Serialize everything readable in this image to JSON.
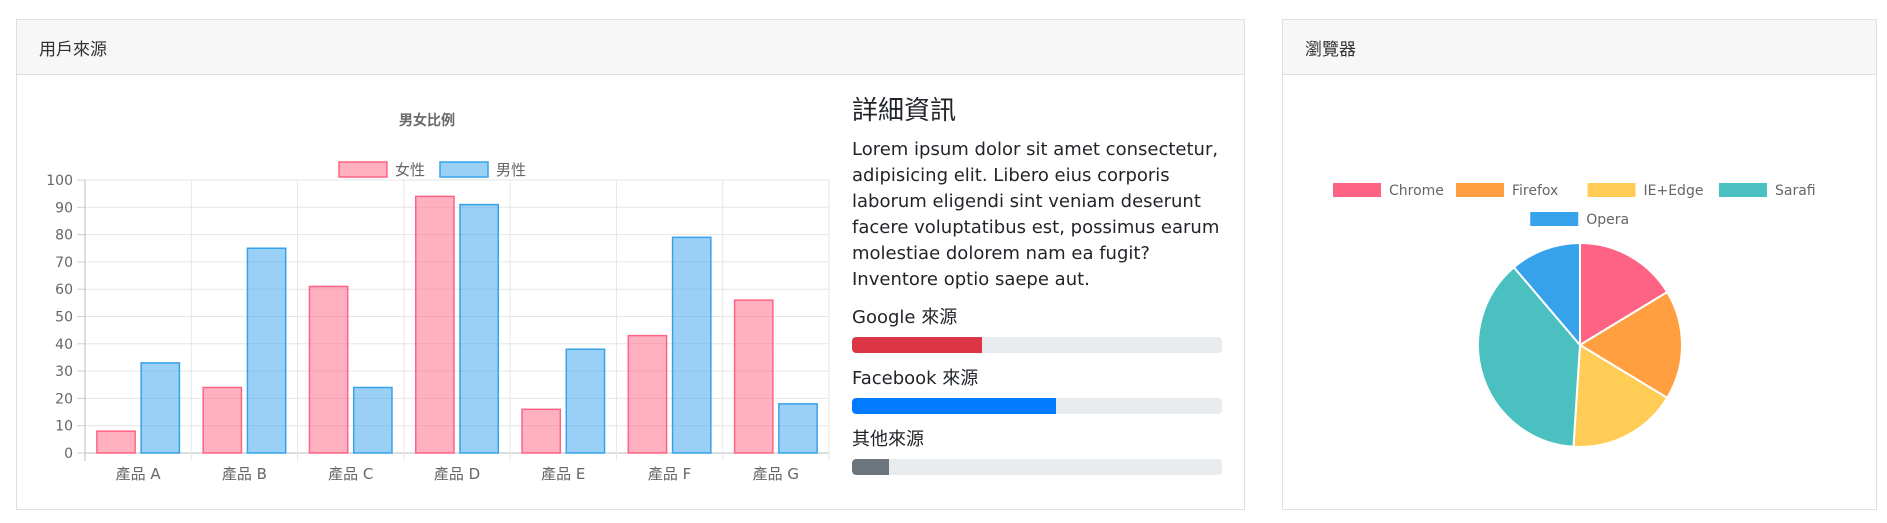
{
  "source_card": {
    "title": "用戶來源",
    "details": {
      "heading": "詳細資訊",
      "body": "Lorem ipsum dolor sit amet consectetur, adipisicing elit. Libero eius corporis laborum eligendi sint veniam deserunt facere voluptatibus est, possimus earum molestiae dolorem nam ea fugit? Inventore optio saepe aut.",
      "progress": [
        {
          "label": "Google 來源",
          "value": 35,
          "color": "#dc3545"
        },
        {
          "label": "Facebook 來源",
          "value": 55,
          "color": "#007bff"
        },
        {
          "label": "其他來源",
          "value": 10,
          "color": "#6c757d"
        }
      ]
    }
  },
  "browser_card": {
    "title": "瀏覽器"
  },
  "chart_data": [
    {
      "type": "bar",
      "title": "男女比例",
      "categories": [
        "產品 A",
        "產品 B",
        "產品 C",
        "產品 D",
        "產品 E",
        "產品 F",
        "產品 G"
      ],
      "series": [
        {
          "name": "女性",
          "values": [
            8,
            24,
            61,
            94,
            16,
            43,
            56
          ],
          "color": "#ff6384"
        },
        {
          "name": "男性",
          "values": [
            33,
            75,
            24,
            91,
            38,
            79,
            18
          ],
          "color": "#36a2eb"
        }
      ],
      "ylim": [
        0,
        100
      ],
      "yticks": [
        0,
        10,
        20,
        30,
        40,
        50,
        60,
        70,
        80,
        90,
        100
      ],
      "grid": true,
      "legend": "top"
    },
    {
      "type": "pie",
      "labels": [
        "Chrome",
        "Firefox",
        "IE+Edge",
        "Sarafi",
        "Opera"
      ],
      "values": [
        16,
        17,
        17,
        37,
        11
      ],
      "colors": [
        "#ff6384",
        "#ff9f40",
        "#ffcd56",
        "#4bc0c0",
        "#36a2eb"
      ],
      "legend": "top"
    }
  ]
}
